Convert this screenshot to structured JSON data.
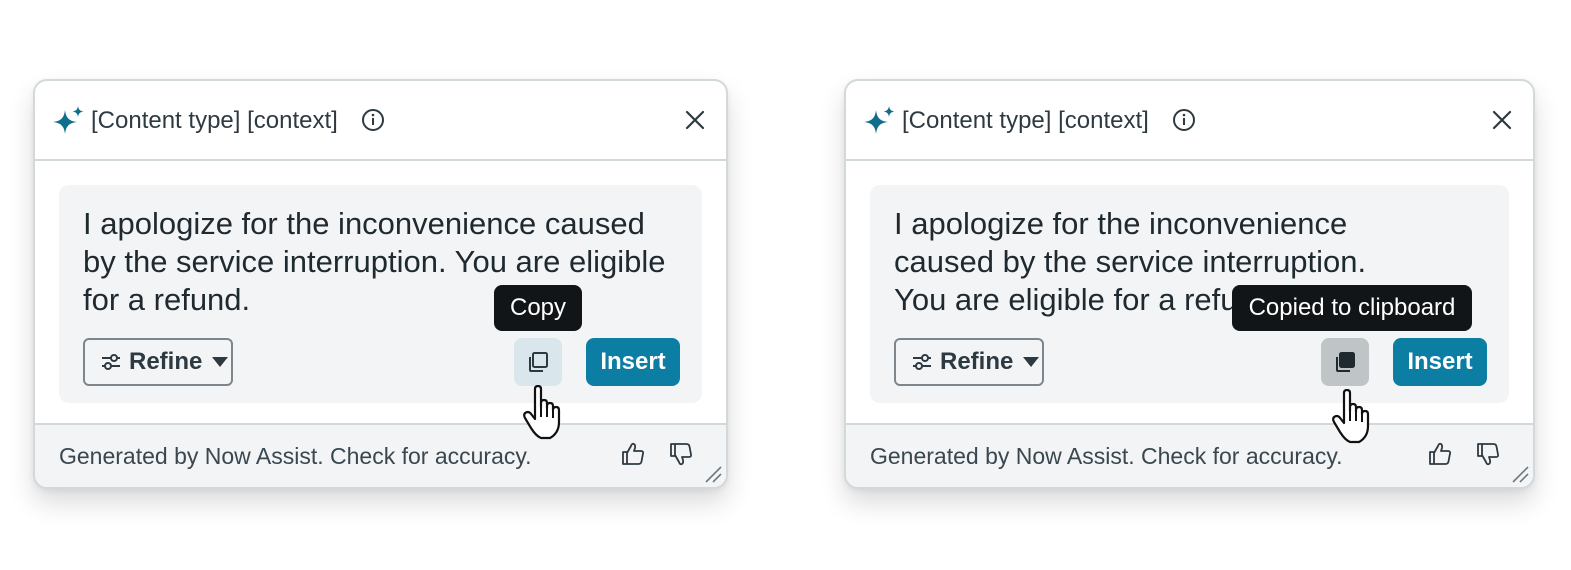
{
  "panels": [
    {
      "state": "hover",
      "header": {
        "title": "[Content type] [context]"
      },
      "message": "I apologize for the inconvenience caused by the service interruption. You are eligible for a refund.",
      "refine_label": "Refine",
      "insert_label": "Insert",
      "tooltip": "Copy",
      "footer_text": "Generated by Now Assist. Check for accuracy."
    },
    {
      "state": "copied",
      "header": {
        "title": "[Content type] [context]"
      },
      "message": "I apologize for the inconvenience caused by the service interruption. You are eligible for a refund.",
      "refine_label": "Refine",
      "insert_label": "Insert",
      "tooltip": "Copied to clipboard",
      "footer_text": "Generated by Now Assist. Check for accuracy."
    }
  ],
  "icons": {
    "header": [
      "sparkle-icon",
      "info-icon",
      "close-icon"
    ],
    "refine": [
      "sliders-icon",
      "caret-down-icon"
    ],
    "actions": [
      "copy-icon",
      "thumbs-up-icon",
      "thumbs-down-icon",
      "resize-handle-icon",
      "pointer-hand-cursor"
    ]
  },
  "colors": {
    "accent": "#0d7ea3",
    "sparkle": "#0e6e8c",
    "tooltip_bg": "#121517",
    "copy_hover_bg": "#d9e7ec",
    "copy_pressed_bg": "#bfc4c7",
    "content_bg": "#f3f4f6"
  }
}
